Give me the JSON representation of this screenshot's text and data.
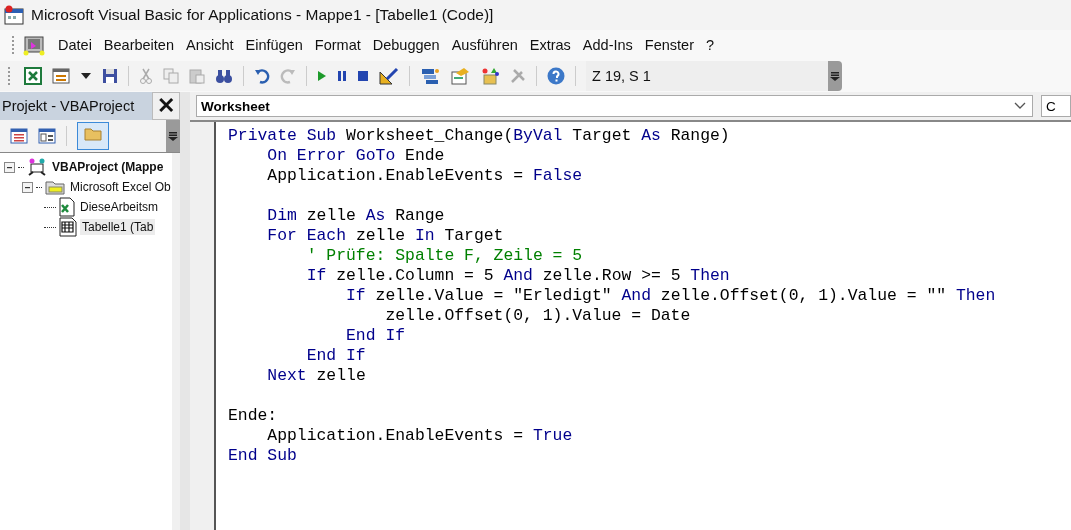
{
  "window": {
    "title": "Microsoft Visual Basic for Applications - Mappe1 - [Tabelle1 (Code)]"
  },
  "menu": [
    {
      "label": "Datei"
    },
    {
      "label": "Bearbeiten"
    },
    {
      "label": "Ansicht"
    },
    {
      "label": "Einfügen"
    },
    {
      "label": "Format"
    },
    {
      "label": "Debuggen"
    },
    {
      "label": "Ausführen"
    },
    {
      "label": "Extras"
    },
    {
      "label": "Add-Ins"
    },
    {
      "label": "Fenster"
    },
    {
      "label": "?"
    }
  ],
  "toolbar": {
    "position": "Z 19, S 1"
  },
  "project_panel": {
    "title": "Projekt - VBAProject",
    "close": "✕",
    "tree": [
      {
        "label": "VBAProject (Mappe",
        "kind": "project",
        "expanded": true,
        "children": [
          {
            "label": "Microsoft Excel Ob",
            "kind": "folder",
            "expanded": true,
            "children": [
              {
                "label": "DieseArbeitsm",
                "kind": "workbook",
                "selected": false
              },
              {
                "label": "Tabelle1 (Tab",
                "kind": "sheet",
                "selected": true
              }
            ]
          }
        ]
      }
    ]
  },
  "code_window": {
    "object_combo": "Worksheet",
    "procedure_combo": "C",
    "lines": [
      [
        {
          "kind": "keyword",
          "text": "Private Sub "
        },
        {
          "kind": "plain",
          "text": "Worksheet_Change("
        },
        {
          "kind": "keyword",
          "text": "ByVal "
        },
        {
          "kind": "plain",
          "text": "Target "
        },
        {
          "kind": "keyword",
          "text": "As "
        },
        {
          "kind": "plain",
          "text": "Range)"
        }
      ],
      [
        {
          "kind": "keyword",
          "text": "    On Error GoTo "
        },
        {
          "kind": "plain",
          "text": "Ende"
        }
      ],
      [
        {
          "kind": "plain",
          "text": "    Application.EnableEvents = "
        },
        {
          "kind": "keyword",
          "text": "False"
        }
      ],
      [
        {
          "kind": "blank"
        }
      ],
      [
        {
          "kind": "keyword",
          "text": "    Dim "
        },
        {
          "kind": "plain",
          "text": "zelle "
        },
        {
          "kind": "keyword",
          "text": "As "
        },
        {
          "kind": "plain",
          "text": "Range"
        }
      ],
      [
        {
          "kind": "keyword",
          "text": "    For Each "
        },
        {
          "kind": "plain",
          "text": "zelle "
        },
        {
          "kind": "keyword",
          "text": "In "
        },
        {
          "kind": "plain",
          "text": "Target"
        }
      ],
      [
        {
          "kind": "comment",
          "text": "        ' Prüfe: Spalte F, Zeile = 5"
        }
      ],
      [
        {
          "kind": "keyword",
          "text": "        If "
        },
        {
          "kind": "plain",
          "text": "zelle.Column = 5 "
        },
        {
          "kind": "keyword",
          "text": "And "
        },
        {
          "kind": "plain",
          "text": "zelle.Row >= 5 "
        },
        {
          "kind": "keyword",
          "text": "Then"
        }
      ],
      [
        {
          "kind": "keyword",
          "text": "            If "
        },
        {
          "kind": "plain",
          "text": "zelle.Value = \"Erledigt\" "
        },
        {
          "kind": "keyword",
          "text": "And "
        },
        {
          "kind": "plain",
          "text": "zelle.Offset(0, 1).Value = \"\" "
        },
        {
          "kind": "keyword",
          "text": "Then"
        }
      ],
      [
        {
          "kind": "plain",
          "text": "                zelle.Offset(0, 1).Value = Date"
        }
      ],
      [
        {
          "kind": "keyword",
          "text": "            End If"
        }
      ],
      [
        {
          "kind": "keyword",
          "text": "        End If"
        }
      ],
      [
        {
          "kind": "keyword",
          "text": "    Next "
        },
        {
          "kind": "plain",
          "text": "zelle"
        }
      ],
      [
        {
          "kind": "blank"
        }
      ],
      [
        {
          "kind": "plain",
          "text": "Ende:"
        }
      ],
      [
        {
          "kind": "plain",
          "text": "    Application.EnableEvents = "
        },
        {
          "kind": "keyword",
          "text": "True"
        }
      ],
      [
        {
          "kind": "keyword",
          "text": "End Sub"
        }
      ]
    ]
  }
}
